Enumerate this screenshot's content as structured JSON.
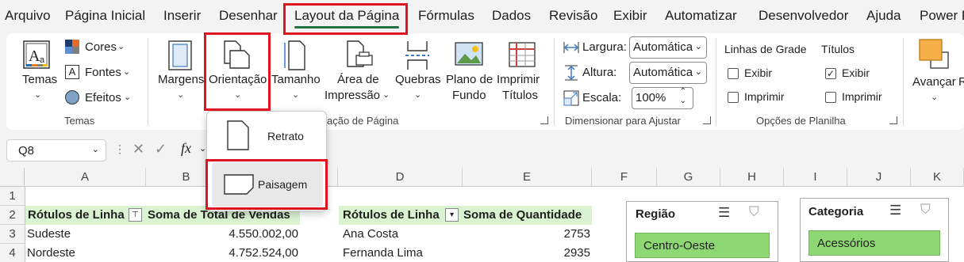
{
  "menu": {
    "items": [
      "Arquivo",
      "Página Inicial",
      "Inserir",
      "Desenhar",
      "Layout da Página",
      "Fórmulas",
      "Dados",
      "Revisão",
      "Exibir",
      "Automatizar",
      "Desenvolvedor",
      "Ajuda",
      "Power P"
    ],
    "active": "Layout da Página"
  },
  "ribbon": {
    "temas": {
      "button": "Temas",
      "cores": "Cores",
      "fontes": "Fontes",
      "efeitos": "Efeitos",
      "group_label": "Temas"
    },
    "configurar": {
      "margens": "Margens",
      "orientacao": "Orientação",
      "tamanho": "Tamanho",
      "area_line1": "Área de",
      "area_line2": "Impressão",
      "quebras": "Quebras",
      "plano_line1": "Plano de",
      "plano_line2": "Fundo",
      "imprimir_line1": "Imprimir",
      "imprimir_line2": "Títulos",
      "group_label_visible": "ação de Página"
    },
    "ajustar": {
      "largura_label": "Largura:",
      "largura_value": "Automática",
      "altura_label": "Altura:",
      "altura_value": "Automática",
      "escala_label": "Escala:",
      "escala_value": "100%",
      "group_label": "Dimensionar para Ajustar"
    },
    "opcoes": {
      "linhas_header": "Linhas de Grade",
      "titulos_header": "Títulos",
      "exibir": "Exibir",
      "imprimir": "Imprimir",
      "group_label": "Opções de Planilha",
      "linhas_exibir_checked": false,
      "linhas_imprimir_checked": false,
      "titulos_exibir_checked": true,
      "titulos_imprimir_checked": false
    },
    "organizar": {
      "avancar": "Avançar",
      "next_partial": "R"
    }
  },
  "orientation_menu": {
    "retrato": "Retrato",
    "paisagem": "Paisagem"
  },
  "formula_bar": {
    "name_box": "Q8",
    "fx": "fx"
  },
  "sheet": {
    "columns": [
      "A",
      "B",
      "C",
      "D",
      "E",
      "F",
      "G",
      "H",
      "I",
      "J",
      "K"
    ],
    "rows": [
      "1",
      "2",
      "3",
      "4"
    ],
    "pivot1": {
      "header_label": "Rótulos de Linha",
      "header_value": "Soma de Total de Vendas",
      "rows": [
        {
          "label": "Sudeste",
          "value": "4.550.002,00"
        },
        {
          "label": "Nordeste",
          "value": "4.752.524,00"
        }
      ]
    },
    "pivot2": {
      "header_label": "Rótulos de Linha",
      "header_value": "Soma de Quantidade",
      "rows": [
        {
          "label": "Ana Costa",
          "value": "2753"
        },
        {
          "label": "Fernanda Lima",
          "value": "2935"
        }
      ]
    }
  },
  "slicers": {
    "regiao": {
      "title": "Região",
      "first_item": "Centro-Oeste"
    },
    "categoria": {
      "title": "Categoria",
      "first_item": "Acessórios"
    }
  },
  "colors": {
    "accent_green": "#217346",
    "pivot_header": "#d9f2d0",
    "slicer_item": "#8ed873",
    "highlight_red": "#e0141e"
  }
}
